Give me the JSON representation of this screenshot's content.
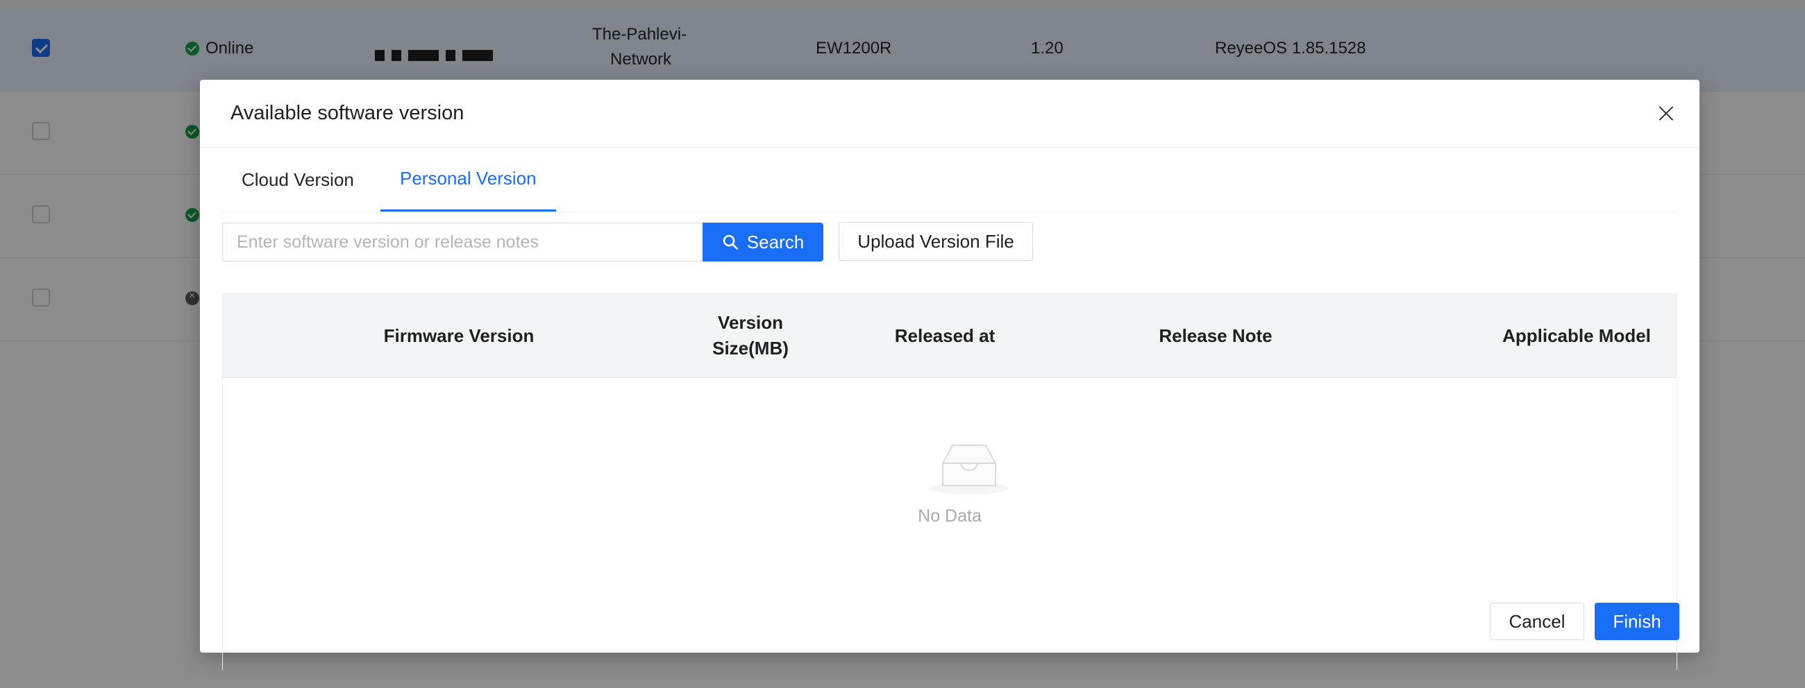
{
  "background_table": {
    "rows": [
      {
        "selected": true,
        "status": "Online",
        "name_line1": "The-Pahlevi-",
        "name_line2": "Network",
        "model": "EW1200R",
        "hw_version": "1.20",
        "software": "ReyeeOS 1.85.1528"
      },
      {
        "selected": false,
        "status": "online"
      },
      {
        "selected": false,
        "status": "online"
      },
      {
        "selected": false,
        "status": "offline"
      }
    ]
  },
  "modal": {
    "title": "Available software version",
    "tabs": [
      {
        "label": "Cloud Version",
        "active": false
      },
      {
        "label": "Personal Version",
        "active": true
      }
    ],
    "search": {
      "placeholder": "Enter software version or release notes",
      "value": "",
      "button_label": "Search"
    },
    "upload_label": "Upload Version File",
    "table": {
      "columns": [
        "Firmware Version",
        "Version Size(MB)",
        "Released at",
        "Release Note",
        "Applicable Model"
      ],
      "columns_display": {
        "firmware": "Firmware Version",
        "size_line1": "Version",
        "size_line2": "Size(MB)",
        "released": "Released at",
        "note": "Release Note",
        "model": "Applicable Model"
      },
      "rows": [],
      "empty_text": "No Data"
    },
    "footer": {
      "cancel_label": "Cancel",
      "finish_label": "Finish"
    }
  },
  "colors": {
    "accent": "#1a6ef5",
    "online": "#16a34a",
    "offline": "#595959",
    "overlay": "rgba(0,0,0,0.45)"
  }
}
